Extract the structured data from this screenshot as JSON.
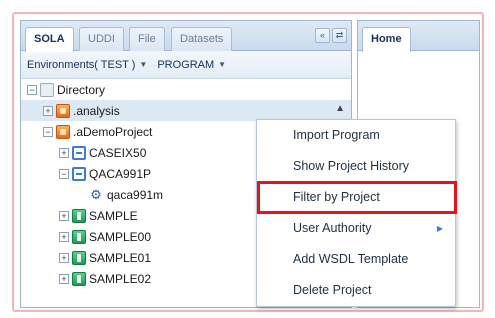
{
  "left_tabs": [
    {
      "label": "SOLA",
      "active": true
    },
    {
      "label": "UDDI",
      "active": false
    },
    {
      "label": "File",
      "active": false
    },
    {
      "label": "Datasets",
      "active": false
    }
  ],
  "tab_tools": {
    "collapse": "«",
    "refresh": "⇄"
  },
  "env_bar": {
    "environment": "Environments( TEST )",
    "program": "PROGRAM"
  },
  "tree": {
    "root": "Directory",
    "items": [
      {
        "label": ".analysis"
      },
      {
        "label": ".aDemoProject"
      },
      {
        "label": "CASEIX50"
      },
      {
        "label": "QACA991P"
      },
      {
        "label": "qaca991m"
      },
      {
        "label": "SAMPLE"
      },
      {
        "label": "SAMPLE00"
      },
      {
        "label": "SAMPLE01"
      },
      {
        "label": "SAMPLE02"
      }
    ]
  },
  "right_tabs": [
    {
      "label": "Home"
    }
  ],
  "context_menu": {
    "items": [
      {
        "label": "Import Program"
      },
      {
        "label": "Show Project History"
      },
      {
        "label": "Filter by Project"
      },
      {
        "label": "User Authority"
      },
      {
        "label": "Add WSDL Template"
      },
      {
        "label": "Delete Project"
      }
    ]
  },
  "colors": {
    "highlight": "#e3141a",
    "selected_row": "#dde8f5",
    "accent": "#3a7bd5"
  }
}
